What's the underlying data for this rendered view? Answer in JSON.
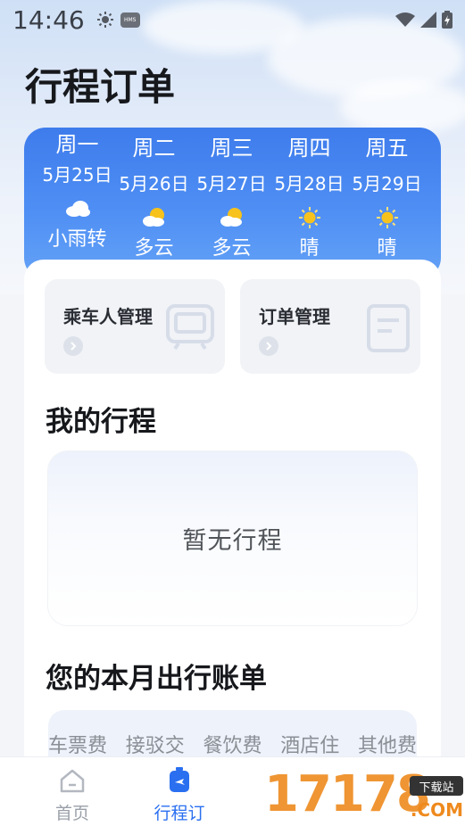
{
  "status_bar": {
    "time": "14:46",
    "hms_badge": "HMS"
  },
  "header": {
    "title": "行程订单"
  },
  "weather": {
    "days": [
      {
        "day": "周一",
        "date": "5月25日",
        "icon": "cloud-icon",
        "desc": "小雨转"
      },
      {
        "day": "周二",
        "date": "5月26日",
        "icon": "partly-cloudy-icon",
        "desc": "多云"
      },
      {
        "day": "周三",
        "date": "5月27日",
        "icon": "partly-cloudy-icon",
        "desc": "多云"
      },
      {
        "day": "周四",
        "date": "5月28日",
        "icon": "sun-icon",
        "desc": "晴"
      },
      {
        "day": "周五",
        "date": "5月29日",
        "icon": "sun-icon",
        "desc": "晴"
      }
    ]
  },
  "quick_actions": [
    {
      "label": "乘车人管理",
      "icon": "passenger-card-icon"
    },
    {
      "label": "订单管理",
      "icon": "order-doc-icon"
    }
  ],
  "my_trips": {
    "title": "我的行程",
    "empty_text": "暂无行程"
  },
  "monthly_bill": {
    "title": "您的本月出行账单",
    "categories": [
      "车票费",
      "接驳交",
      "餐饮费",
      "酒店住",
      "其他费"
    ]
  },
  "tabbar": {
    "items": [
      {
        "label": "首页",
        "icon": "home-icon",
        "active": false
      },
      {
        "label": "行程订",
        "icon": "trip-luggage-icon",
        "active": true
      }
    ],
    "active_color": "#2a6ff0",
    "inactive_color": "#9aa0a8"
  },
  "watermark": {
    "number": "17178",
    "tag": "下载站",
    "suffix": ".COM"
  },
  "colors": {
    "accent": "#3e7cec",
    "sun": "#f7c21b"
  }
}
